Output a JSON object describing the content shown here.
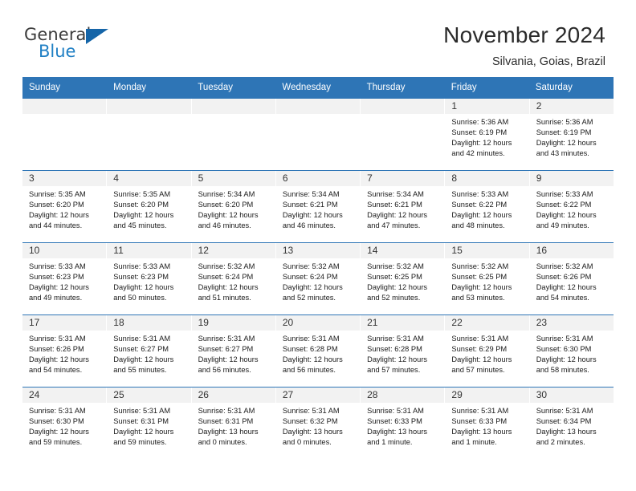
{
  "logo": {
    "general": "General",
    "blue": "Blue",
    "triangle": "blue-triangle"
  },
  "header": {
    "title": "November 2024",
    "subtitle": "Silvania, Goias, Brazil"
  },
  "colors": {
    "header_blue": "#2e75b6",
    "daynum_band": "#f2f2f2",
    "logo_blue": "#1f7fc4",
    "text": "#1a1a1a"
  },
  "weekdays": [
    "Sunday",
    "Monday",
    "Tuesday",
    "Wednesday",
    "Thursday",
    "Friday",
    "Saturday"
  ],
  "labels": {
    "sunrise": "Sunrise:",
    "sunset": "Sunset:",
    "daylight": "Daylight:"
  },
  "weeks": [
    [
      {
        "day": "",
        "empty": true
      },
      {
        "day": "",
        "empty": true
      },
      {
        "day": "",
        "empty": true
      },
      {
        "day": "",
        "empty": true
      },
      {
        "day": "",
        "empty": true
      },
      {
        "day": "1",
        "sunrise": "Sunrise: 5:36 AM",
        "sunset": "Sunset: 6:19 PM",
        "daylight_1": "Daylight: 12 hours",
        "daylight_2": "and 42 minutes."
      },
      {
        "day": "2",
        "sunrise": "Sunrise: 5:36 AM",
        "sunset": "Sunset: 6:19 PM",
        "daylight_1": "Daylight: 12 hours",
        "daylight_2": "and 43 minutes."
      }
    ],
    [
      {
        "day": "3",
        "sunrise": "Sunrise: 5:35 AM",
        "sunset": "Sunset: 6:20 PM",
        "daylight_1": "Daylight: 12 hours",
        "daylight_2": "and 44 minutes."
      },
      {
        "day": "4",
        "sunrise": "Sunrise: 5:35 AM",
        "sunset": "Sunset: 6:20 PM",
        "daylight_1": "Daylight: 12 hours",
        "daylight_2": "and 45 minutes."
      },
      {
        "day": "5",
        "sunrise": "Sunrise: 5:34 AM",
        "sunset": "Sunset: 6:20 PM",
        "daylight_1": "Daylight: 12 hours",
        "daylight_2": "and 46 minutes."
      },
      {
        "day": "6",
        "sunrise": "Sunrise: 5:34 AM",
        "sunset": "Sunset: 6:21 PM",
        "daylight_1": "Daylight: 12 hours",
        "daylight_2": "and 46 minutes."
      },
      {
        "day": "7",
        "sunrise": "Sunrise: 5:34 AM",
        "sunset": "Sunset: 6:21 PM",
        "daylight_1": "Daylight: 12 hours",
        "daylight_2": "and 47 minutes."
      },
      {
        "day": "8",
        "sunrise": "Sunrise: 5:33 AM",
        "sunset": "Sunset: 6:22 PM",
        "daylight_1": "Daylight: 12 hours",
        "daylight_2": "and 48 minutes."
      },
      {
        "day": "9",
        "sunrise": "Sunrise: 5:33 AM",
        "sunset": "Sunset: 6:22 PM",
        "daylight_1": "Daylight: 12 hours",
        "daylight_2": "and 49 minutes."
      }
    ],
    [
      {
        "day": "10",
        "sunrise": "Sunrise: 5:33 AM",
        "sunset": "Sunset: 6:23 PM",
        "daylight_1": "Daylight: 12 hours",
        "daylight_2": "and 49 minutes."
      },
      {
        "day": "11",
        "sunrise": "Sunrise: 5:33 AM",
        "sunset": "Sunset: 6:23 PM",
        "daylight_1": "Daylight: 12 hours",
        "daylight_2": "and 50 minutes."
      },
      {
        "day": "12",
        "sunrise": "Sunrise: 5:32 AM",
        "sunset": "Sunset: 6:24 PM",
        "daylight_1": "Daylight: 12 hours",
        "daylight_2": "and 51 minutes."
      },
      {
        "day": "13",
        "sunrise": "Sunrise: 5:32 AM",
        "sunset": "Sunset: 6:24 PM",
        "daylight_1": "Daylight: 12 hours",
        "daylight_2": "and 52 minutes."
      },
      {
        "day": "14",
        "sunrise": "Sunrise: 5:32 AM",
        "sunset": "Sunset: 6:25 PM",
        "daylight_1": "Daylight: 12 hours",
        "daylight_2": "and 52 minutes."
      },
      {
        "day": "15",
        "sunrise": "Sunrise: 5:32 AM",
        "sunset": "Sunset: 6:25 PM",
        "daylight_1": "Daylight: 12 hours",
        "daylight_2": "and 53 minutes."
      },
      {
        "day": "16",
        "sunrise": "Sunrise: 5:32 AM",
        "sunset": "Sunset: 6:26 PM",
        "daylight_1": "Daylight: 12 hours",
        "daylight_2": "and 54 minutes."
      }
    ],
    [
      {
        "day": "17",
        "sunrise": "Sunrise: 5:31 AM",
        "sunset": "Sunset: 6:26 PM",
        "daylight_1": "Daylight: 12 hours",
        "daylight_2": "and 54 minutes."
      },
      {
        "day": "18",
        "sunrise": "Sunrise: 5:31 AM",
        "sunset": "Sunset: 6:27 PM",
        "daylight_1": "Daylight: 12 hours",
        "daylight_2": "and 55 minutes."
      },
      {
        "day": "19",
        "sunrise": "Sunrise: 5:31 AM",
        "sunset": "Sunset: 6:27 PM",
        "daylight_1": "Daylight: 12 hours",
        "daylight_2": "and 56 minutes."
      },
      {
        "day": "20",
        "sunrise": "Sunrise: 5:31 AM",
        "sunset": "Sunset: 6:28 PM",
        "daylight_1": "Daylight: 12 hours",
        "daylight_2": "and 56 minutes."
      },
      {
        "day": "21",
        "sunrise": "Sunrise: 5:31 AM",
        "sunset": "Sunset: 6:28 PM",
        "daylight_1": "Daylight: 12 hours",
        "daylight_2": "and 57 minutes."
      },
      {
        "day": "22",
        "sunrise": "Sunrise: 5:31 AM",
        "sunset": "Sunset: 6:29 PM",
        "daylight_1": "Daylight: 12 hours",
        "daylight_2": "and 57 minutes."
      },
      {
        "day": "23",
        "sunrise": "Sunrise: 5:31 AM",
        "sunset": "Sunset: 6:30 PM",
        "daylight_1": "Daylight: 12 hours",
        "daylight_2": "and 58 minutes."
      }
    ],
    [
      {
        "day": "24",
        "sunrise": "Sunrise: 5:31 AM",
        "sunset": "Sunset: 6:30 PM",
        "daylight_1": "Daylight: 12 hours",
        "daylight_2": "and 59 minutes."
      },
      {
        "day": "25",
        "sunrise": "Sunrise: 5:31 AM",
        "sunset": "Sunset: 6:31 PM",
        "daylight_1": "Daylight: 12 hours",
        "daylight_2": "and 59 minutes."
      },
      {
        "day": "26",
        "sunrise": "Sunrise: 5:31 AM",
        "sunset": "Sunset: 6:31 PM",
        "daylight_1": "Daylight: 13 hours",
        "daylight_2": "and 0 minutes."
      },
      {
        "day": "27",
        "sunrise": "Sunrise: 5:31 AM",
        "sunset": "Sunset: 6:32 PM",
        "daylight_1": "Daylight: 13 hours",
        "daylight_2": "and 0 minutes."
      },
      {
        "day": "28",
        "sunrise": "Sunrise: 5:31 AM",
        "sunset": "Sunset: 6:33 PM",
        "daylight_1": "Daylight: 13 hours",
        "daylight_2": "and 1 minute."
      },
      {
        "day": "29",
        "sunrise": "Sunrise: 5:31 AM",
        "sunset": "Sunset: 6:33 PM",
        "daylight_1": "Daylight: 13 hours",
        "daylight_2": "and 1 minute."
      },
      {
        "day": "30",
        "sunrise": "Sunrise: 5:31 AM",
        "sunset": "Sunset: 6:34 PM",
        "daylight_1": "Daylight: 13 hours",
        "daylight_2": "and 2 minutes."
      }
    ]
  ]
}
